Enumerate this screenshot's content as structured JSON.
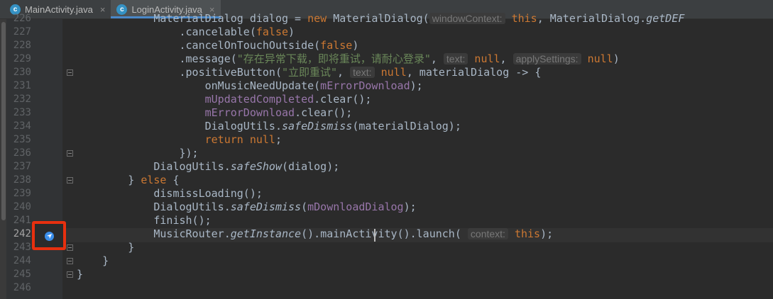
{
  "tabs": [
    {
      "label": "MainActivity.java",
      "icon": "c",
      "active": false
    },
    {
      "label": "LoginActivity.java",
      "icon": "c",
      "active": true
    }
  ],
  "lines": [
    {
      "num": "226",
      "tokens": [
        {
          "t": "            MaterialDialog dialog = ",
          "c": "p"
        },
        {
          "t": "new",
          "c": "kw"
        },
        {
          "t": " MaterialDialog(",
          "c": "p"
        },
        {
          "t": "windowContext:",
          "c": "hint"
        },
        {
          "t": " ",
          "c": "p"
        },
        {
          "t": "this",
          "c": "kw"
        },
        {
          "t": ", MaterialDialog.",
          "c": "p"
        },
        {
          "t": "getDEF",
          "c": "it"
        }
      ]
    },
    {
      "num": "227",
      "tokens": [
        {
          "t": "                .cancelable(",
          "c": "p"
        },
        {
          "t": "false",
          "c": "kw"
        },
        {
          "t": ")",
          "c": "p"
        }
      ]
    },
    {
      "num": "228",
      "tokens": [
        {
          "t": "                .cancelOnTouchOutside(",
          "c": "p"
        },
        {
          "t": "false",
          "c": "kw"
        },
        {
          "t": ")",
          "c": "p"
        }
      ]
    },
    {
      "num": "229",
      "tokens": [
        {
          "t": "                .message(",
          "c": "p"
        },
        {
          "t": "\"存在异常下载，即将重试，请耐心登录\"",
          "c": "str"
        },
        {
          "t": ", ",
          "c": "p"
        },
        {
          "t": "text:",
          "c": "hint"
        },
        {
          "t": " ",
          "c": "p"
        },
        {
          "t": "null",
          "c": "kw"
        },
        {
          "t": ", ",
          "c": "p"
        },
        {
          "t": "applySettings:",
          "c": "hint"
        },
        {
          "t": " ",
          "c": "p"
        },
        {
          "t": "null",
          "c": "kw"
        },
        {
          "t": ")",
          "c": "p"
        }
      ]
    },
    {
      "num": "230",
      "tokens": [
        {
          "t": "                .positiveButton(",
          "c": "p"
        },
        {
          "t": "\"立即重试\"",
          "c": "str"
        },
        {
          "t": ", ",
          "c": "p"
        },
        {
          "t": "text:",
          "c": "hint"
        },
        {
          "t": " ",
          "c": "p"
        },
        {
          "t": "null",
          "c": "kw"
        },
        {
          "t": ", materialDialog -> {",
          "c": "p"
        }
      ]
    },
    {
      "num": "231",
      "tokens": [
        {
          "t": "                    onMusicNeedUpdate(",
          "c": "p"
        },
        {
          "t": "mErrorDownload",
          "c": "field"
        },
        {
          "t": ");",
          "c": "p"
        }
      ]
    },
    {
      "num": "232",
      "tokens": [
        {
          "t": "                    ",
          "c": "p"
        },
        {
          "t": "mUpdatedCompleted",
          "c": "field"
        },
        {
          "t": ".clear();",
          "c": "p"
        }
      ]
    },
    {
      "num": "233",
      "tokens": [
        {
          "t": "                    ",
          "c": "p"
        },
        {
          "t": "mErrorDownload",
          "c": "field"
        },
        {
          "t": ".clear();",
          "c": "p"
        }
      ]
    },
    {
      "num": "234",
      "tokens": [
        {
          "t": "                    DialogUtils.",
          "c": "p"
        },
        {
          "t": "safeDismiss",
          "c": "it"
        },
        {
          "t": "(materialDialog);",
          "c": "p"
        }
      ]
    },
    {
      "num": "235",
      "tokens": [
        {
          "t": "                    ",
          "c": "p"
        },
        {
          "t": "return null",
          "c": "kw"
        },
        {
          "t": ";",
          "c": "p"
        }
      ]
    },
    {
      "num": "236",
      "tokens": [
        {
          "t": "                });",
          "c": "p"
        }
      ]
    },
    {
      "num": "237",
      "tokens": [
        {
          "t": "            DialogUtils.",
          "c": "p"
        },
        {
          "t": "safeShow",
          "c": "it"
        },
        {
          "t": "(dialog);",
          "c": "p"
        }
      ]
    },
    {
      "num": "238",
      "tokens": [
        {
          "t": "        } ",
          "c": "p"
        },
        {
          "t": "else",
          "c": "kw"
        },
        {
          "t": " {",
          "c": "p"
        }
      ]
    },
    {
      "num": "239",
      "tokens": [
        {
          "t": "            dismissLoading();",
          "c": "p"
        }
      ]
    },
    {
      "num": "240",
      "tokens": [
        {
          "t": "            DialogUtils.",
          "c": "p"
        },
        {
          "t": "safeDismiss",
          "c": "it"
        },
        {
          "t": "(",
          "c": "p"
        },
        {
          "t": "mDownloadDialog",
          "c": "field"
        },
        {
          "t": ");",
          "c": "p"
        }
      ]
    },
    {
      "num": "241",
      "tokens": [
        {
          "t": "            finish();",
          "c": "p"
        }
      ]
    },
    {
      "num": "242",
      "tokens": [
        {
          "t": "            MusicRouter.",
          "c": "p"
        },
        {
          "t": "getInstance",
          "c": "it"
        },
        {
          "t": "().",
          "c": "p"
        },
        {
          "t": "mainActivity",
          "c": "p"
        },
        {
          "t": "().launch( ",
          "c": "p"
        },
        {
          "t": "context:",
          "c": "hint"
        },
        {
          "t": " ",
          "c": "p"
        },
        {
          "t": "this",
          "c": "kw"
        },
        {
          "t": ");",
          "c": "p"
        }
      ]
    },
    {
      "num": "243",
      "tokens": [
        {
          "t": "        }",
          "c": "p"
        }
      ]
    },
    {
      "num": "244",
      "tokens": [
        {
          "t": "    }",
          "c": "p"
        }
      ]
    },
    {
      "num": "245",
      "tokens": [
        {
          "t": "}",
          "c": "p"
        }
      ]
    },
    {
      "num": "246",
      "tokens": []
    }
  ],
  "colors": {
    "keyword": "#cc7832",
    "string": "#6a8759",
    "field": "#9876aa",
    "plain": "#a9b7c6",
    "marker": "#e8300f",
    "accent": "#4a88c7"
  },
  "gutter_marker": {
    "icon": "navigate-arrow-icon"
  }
}
